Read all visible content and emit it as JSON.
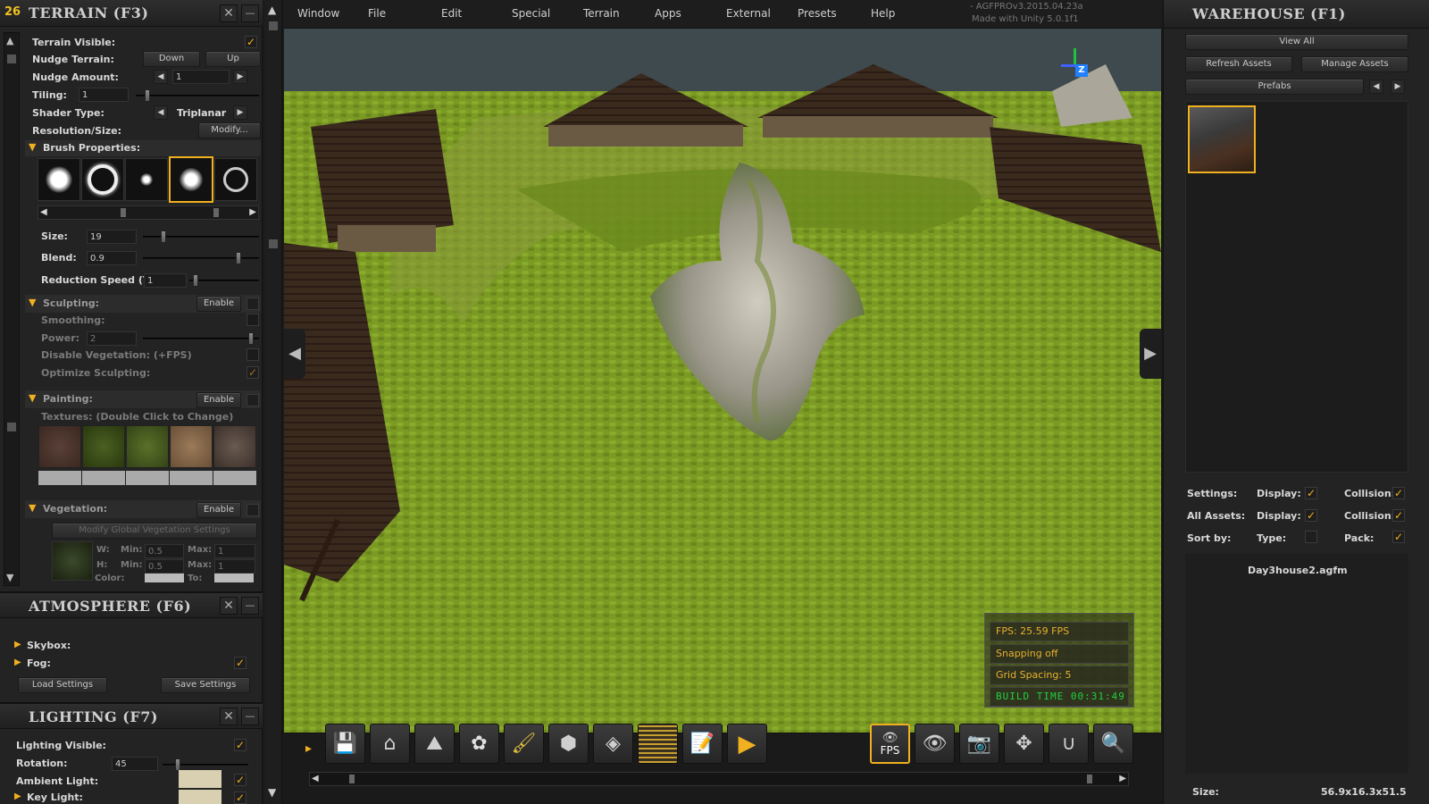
{
  "build_badge": "26",
  "terrain": {
    "title": "TERRAIN (F3)",
    "visible_label": "Terrain Visible:",
    "nudge_label": "Nudge Terrain:",
    "nudge_down": "Down",
    "nudge_up": "Up",
    "nudge_amount_label": "Nudge Amount:",
    "nudge_amount": "1",
    "tiling_label": "Tiling:",
    "tiling": "1",
    "shader_label": "Shader Type:",
    "shader": "Triplanar",
    "resolution_label": "Resolution/Size:",
    "modify": "Modify...",
    "brush_label": "Brush Properties:",
    "size_label": "Size:",
    "size": "19",
    "blend_label": "Blend:",
    "blend": "0.9",
    "reduction_label": "Reduction Speed (T):",
    "reduction": "1",
    "sculpting_label": "Sculpting:",
    "enable": "Enable",
    "smoothing_label": "Smoothing:",
    "power_label": "Power:",
    "power": "2",
    "disable_veg_label": "Disable Vegetation: (+FPS)",
    "optimize_label": "Optimize Sculpting:",
    "painting_label": "Painting:",
    "textures_label": "Textures: (Double Click to Change)",
    "vegetation_label": "Vegetation:",
    "modify_veg": "Modify Global Vegetation Settings",
    "w_label": "W:",
    "h_label": "H:",
    "min_label": "Min:",
    "max_label": "Max:",
    "w_min": "0.5",
    "w_max": "1",
    "h_min": "0.5",
    "h_max": "1",
    "color_label": "Color:",
    "to_label": "To:"
  },
  "atmosphere": {
    "title": "ATMOSPHERE (F6)",
    "skybox": "Skybox:",
    "fog": "Fog:",
    "load": "Load Settings",
    "save": "Save Settings"
  },
  "lighting": {
    "title": "LIGHTING (F7)",
    "visible": "Lighting Visible:",
    "rotation_label": "Rotation:",
    "rotation": "45",
    "ambient": "Ambient Light:",
    "key": "Key Light:"
  },
  "menu": [
    "Window",
    "File",
    "Edit",
    "Special",
    "Terrain",
    "Apps",
    "External",
    "Presets",
    "Help"
  ],
  "version": "- AGFPROv3.2015.04.23a",
  "made_with": "Made with Unity 5.0.1f1",
  "hud": {
    "fps": "FPS: 25.59 FPS",
    "snapping": "Snapping off",
    "grid": "Grid Spacing: 5",
    "build_time": "BUILD TIME 00:31:49"
  },
  "toolbar": {
    "fps_label": "FPS",
    "icons": [
      "save-icon",
      "house-icon",
      "terrain-icon",
      "flower-icon",
      "paint-brush-icon",
      "cube-grid-icon",
      "cube-icon",
      "grid-icon",
      "notepad-icon",
      "play-icon"
    ],
    "right_icons": [
      "eye-fps-icon",
      "eye-play-icon",
      "camera-icon",
      "move-icon",
      "magnet-icon",
      "zoom-icon"
    ]
  },
  "warehouse": {
    "title": "WAREHOUSE (F1)",
    "view_all": "View All",
    "refresh": "Refresh Assets",
    "manage": "Manage Assets",
    "prefabs": "Prefabs",
    "settings_label": "Settings:",
    "all_assets_label": "All Assets:",
    "sort_label": "Sort by:",
    "display": "Display:",
    "collision": "Collision:",
    "type": "Type:",
    "pack": "Pack:",
    "selected_file": "Day3house2.agfm",
    "size_label": "Size:",
    "size_value": "56.9x16.3x51.5"
  },
  "colors": {
    "accent": "#f0b020",
    "hud_text": "#e8b030",
    "build_time": "#20d040",
    "grass": "#6e8a1e"
  }
}
